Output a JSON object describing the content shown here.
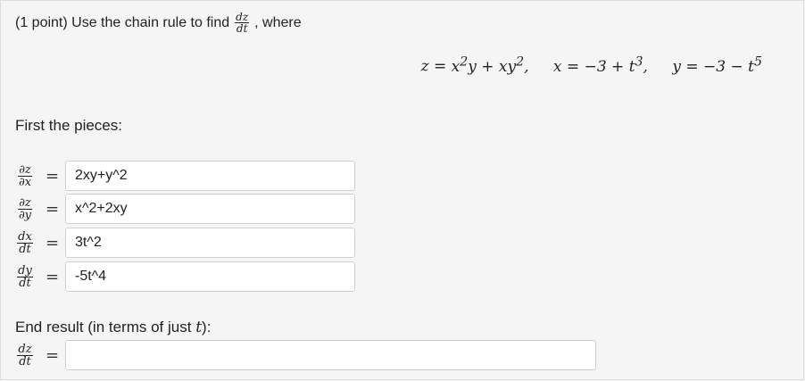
{
  "question": {
    "prefix": "(1 point) Use the chain rule to find",
    "suffix": ", where",
    "target_num": "dz",
    "target_den": "dt"
  },
  "equations": [
    {
      "lhs": "z",
      "rhs_html": "x<sup>2</sup>y + xy<sup>2</sup>,"
    },
    {
      "lhs": "x",
      "rhs_html": "−3 + t<sup>3</sup>,"
    },
    {
      "lhs": "y",
      "rhs_html": "−3 − t<sup>5</sup>"
    }
  ],
  "pieces_label": "First the pieces:",
  "pieces": [
    {
      "num": "∂z",
      "den": "∂x",
      "value": "2xy+y^2"
    },
    {
      "num": "∂z",
      "den": "∂y",
      "value": "x^2+2xy"
    },
    {
      "num": "dx",
      "den": "dt",
      "value": "3t^2"
    },
    {
      "num": "dy",
      "den": "dt",
      "value": "-5t^4"
    }
  ],
  "end_label_prefix": "End result (in terms of just ",
  "end_label_var": "t",
  "end_label_suffix": "):",
  "end_result": {
    "num": "dz",
    "den": "dt",
    "value": ""
  }
}
